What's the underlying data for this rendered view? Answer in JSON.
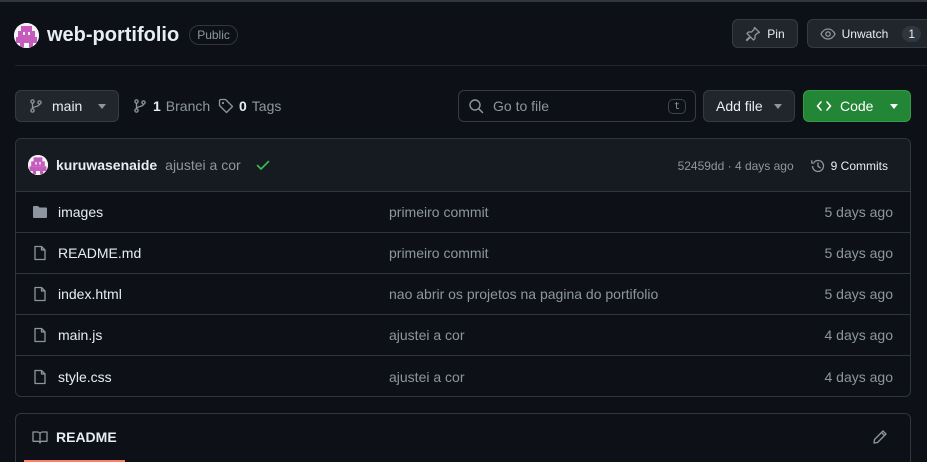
{
  "repo": {
    "name": "web-portifolio",
    "visibility": "Public",
    "actions": {
      "pin_label": "Pin",
      "unwatch_label": "Unwatch",
      "watch_count": "1"
    }
  },
  "toolbar": {
    "branch_name": "main",
    "branch_count": "1",
    "branch_label": "Branch",
    "tag_count": "0",
    "tag_label": "Tags",
    "search_placeholder": "Go to file",
    "search_shortcut": "t",
    "add_file_label": "Add file",
    "code_label": "Code"
  },
  "latest_commit": {
    "author": "kuruwasenaide",
    "message": "ajustei a cor",
    "hash_and_time": "52459dd · 4 days ago",
    "commits_label": "9 Commits"
  },
  "files": [
    {
      "type": "folder",
      "icon": "folder-icon",
      "name": "images",
      "message": "primeiro commit",
      "date": "5 days ago"
    },
    {
      "type": "file",
      "icon": "file-icon",
      "name": "README.md",
      "message": "primeiro commit",
      "date": "5 days ago"
    },
    {
      "type": "file",
      "icon": "file-icon",
      "name": "index.html",
      "message": "nao abrir os projetos na pagina do portifolio",
      "date": "5 days ago"
    },
    {
      "type": "file",
      "icon": "file-icon",
      "name": "main.js",
      "message": "ajustei a cor",
      "date": "4 days ago"
    },
    {
      "type": "file",
      "icon": "file-icon",
      "name": "style.css",
      "message": "ajustei a cor",
      "date": "4 days ago"
    }
  ],
  "readme": {
    "title": "README"
  },
  "colors": {
    "background": "#0d1117",
    "accent_green": "#238636",
    "text": "#e6edf3",
    "muted": "#8d96a0",
    "border": "#30363d",
    "readme_underline": "#f78166"
  }
}
